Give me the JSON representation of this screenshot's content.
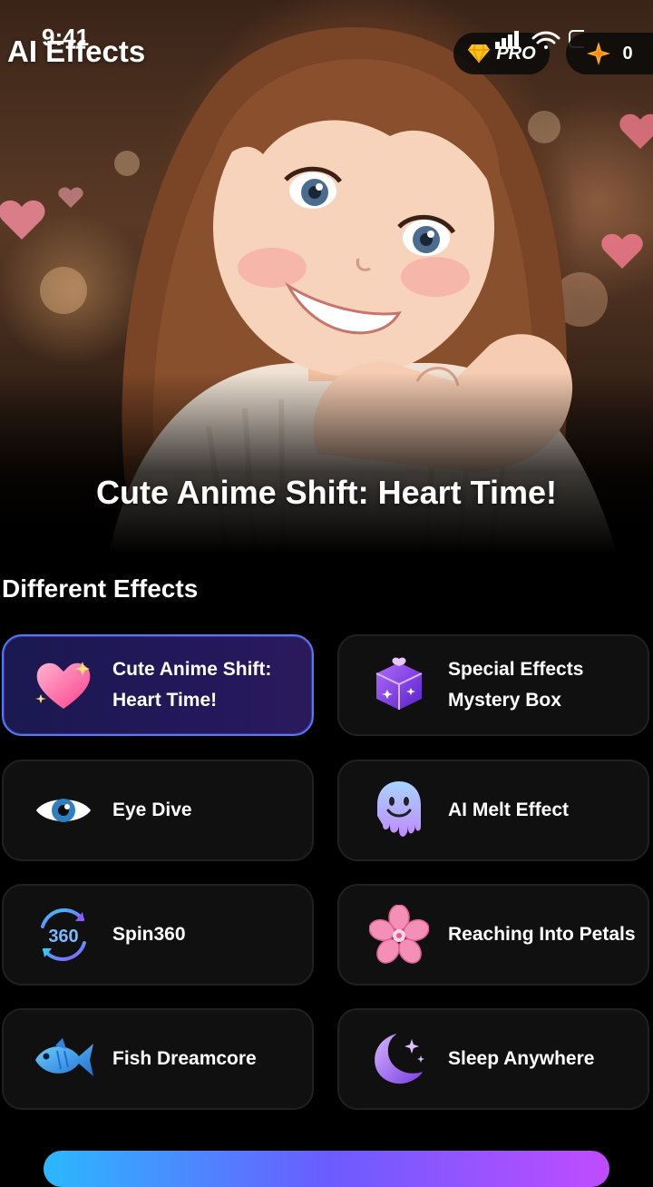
{
  "status_bar": {
    "time": "9:41"
  },
  "header": {
    "title": "AI Effects",
    "pro_label": "PRO",
    "credits": "0"
  },
  "hero": {
    "title": "Cute Anime Shift: Heart Time!"
  },
  "section": {
    "title": "Different Effects"
  },
  "effects": [
    {
      "label": "Cute Anime Shift: Heart Time!",
      "line1": "Cute Anime Shift:",
      "line2": "Heart Time!",
      "icon": "sparkling-heart-icon",
      "selected": true
    },
    {
      "label": "Special Effects Mystery Box",
      "line1": "Special Effects",
      "line2": "Mystery Box",
      "icon": "mystery-box-icon",
      "selected": false
    },
    {
      "label": "Eye Dive",
      "icon": "eye-icon",
      "selected": false
    },
    {
      "label": "AI Melt Effect",
      "icon": "melting-face-icon",
      "selected": false
    },
    {
      "label": "Spin360",
      "icon": "spin-360-icon",
      "selected": false
    },
    {
      "label": "Reaching Into Petals",
      "icon": "cherry-blossom-icon",
      "selected": false
    },
    {
      "label": "Fish Dreamcore",
      "icon": "fish-icon",
      "selected": false
    },
    {
      "label": "Sleep Anywhere",
      "icon": "crescent-moon-icon",
      "selected": false
    }
  ],
  "colors": {
    "accent_blue": "#4e7cf7",
    "accent_purple": "#8a5cff",
    "card_bg": "#101010",
    "page_bg": "#000000"
  }
}
